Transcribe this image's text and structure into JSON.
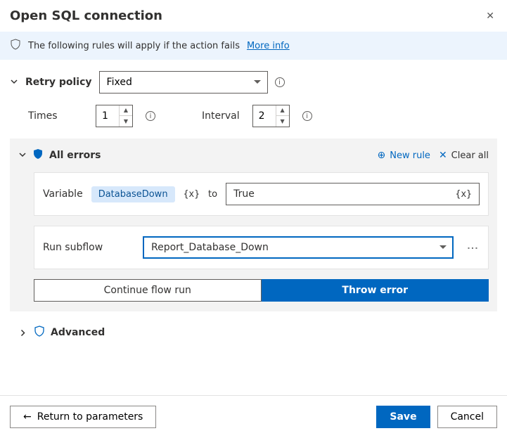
{
  "header": {
    "title": "Open SQL connection"
  },
  "banner": {
    "text": "The following rules will apply if the action fails",
    "more_link": "More info"
  },
  "retry": {
    "label": "Retry policy",
    "mode": "Fixed",
    "times_label": "Times",
    "times_value": "1",
    "interval_label": "Interval",
    "interval_value": "2"
  },
  "errors": {
    "title": "All errors",
    "new_rule": "New rule",
    "clear_all": "Clear all",
    "variable_label": "Variable",
    "variable_name": "DatabaseDown",
    "to_label": "to",
    "variable_value": "True",
    "subflow_label": "Run subflow",
    "subflow_value": "Report_Database_Down",
    "seg_continue": "Continue flow run",
    "seg_throw": "Throw error"
  },
  "advanced": {
    "label": "Advanced"
  },
  "footer": {
    "return": "Return to parameters",
    "save": "Save",
    "cancel": "Cancel"
  }
}
